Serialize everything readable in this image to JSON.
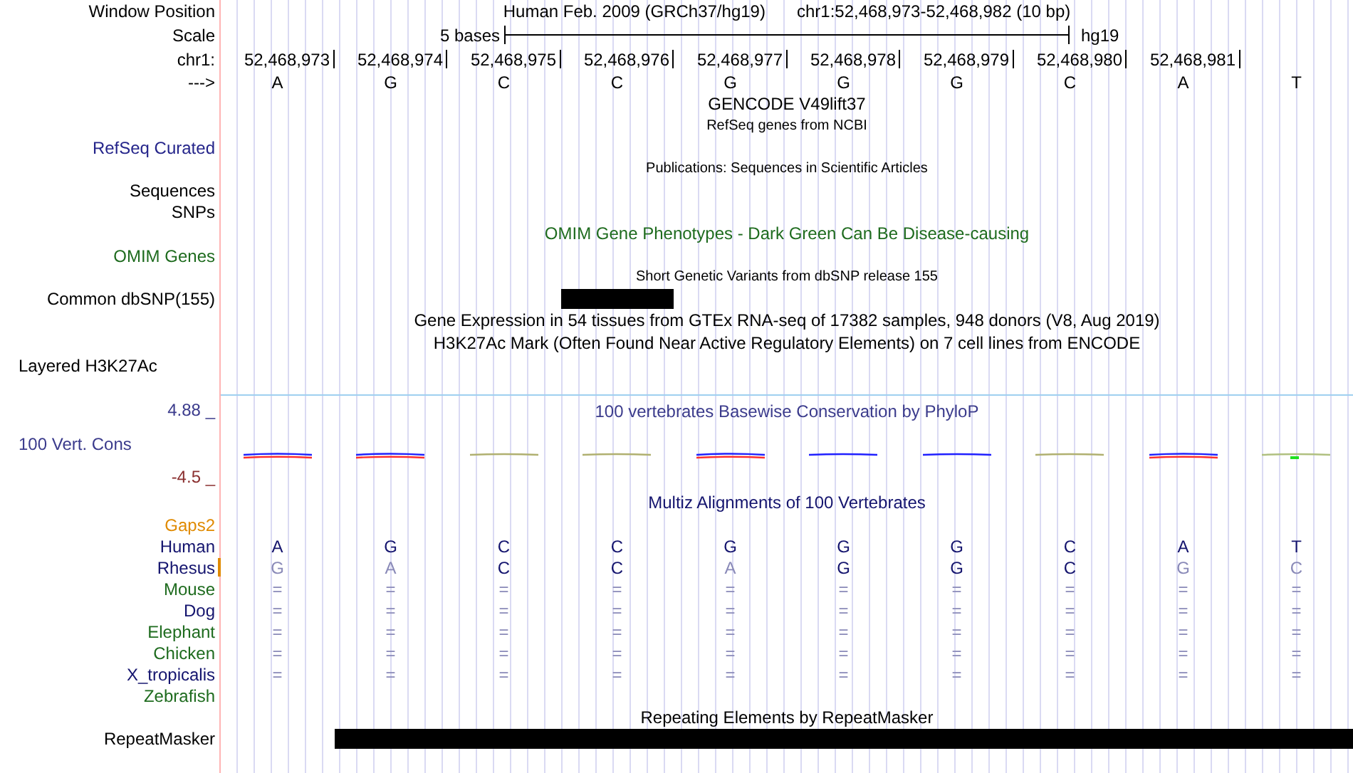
{
  "header": {
    "label": "Window Position",
    "assembly": "Human Feb. 2009 (GRCh37/hg19)",
    "position": "chr1:52,468,973-52,468,982 (10 bp)"
  },
  "scale": {
    "label": "Scale",
    "bar_label": "5 bases",
    "assembly": "hg19"
  },
  "ruler": {
    "label": "chr1:",
    "positions": [
      "52,468,973",
      "52,468,974",
      "52,468,975",
      "52,468,976",
      "52,468,977",
      "52,468,978",
      "52,468,979",
      "52,468,980",
      "52,468,981"
    ]
  },
  "sequence": {
    "label": "--->",
    "bases": [
      "A",
      "G",
      "C",
      "C",
      "G",
      "G",
      "G",
      "C",
      "A",
      "T"
    ]
  },
  "tracks": [
    {
      "kind": "title",
      "text": "GENCODE V49lift37",
      "color": "#000000"
    },
    {
      "kind": "subtitle",
      "text": "RefSeq genes from NCBI",
      "color": "#000000"
    },
    {
      "kind": "label",
      "text": "RefSeq Curated",
      "color": "#24248a"
    },
    {
      "kind": "subtitle",
      "text": "Publications: Sequences in Scientific Articles",
      "color": "#000000"
    },
    {
      "kind": "label",
      "text": "Sequences",
      "color": "#000000"
    },
    {
      "kind": "label",
      "text": "SNPs",
      "color": "#000000"
    },
    {
      "kind": "title",
      "text": "OMIM Gene Phenotypes - Dark Green Can Be Disease-causing",
      "color": "#1e6b1e"
    },
    {
      "kind": "label",
      "text": "OMIM Genes",
      "color": "#1e6b1e"
    },
    {
      "kind": "subtitle",
      "text": "Short Genetic Variants from dbSNP release 155",
      "color": "#000000"
    },
    {
      "kind": "feature",
      "text": "Common dbSNP(155)",
      "color": "#000000",
      "covered": [
        false,
        false,
        false,
        true,
        false,
        false,
        false,
        false,
        false,
        false
      ]
    },
    {
      "kind": "title",
      "text": "Gene Expression in 54 tissues from GTEx RNA-seq of 17382 samples, 948 donors (V8, Aug 2019)",
      "color": "#000000"
    },
    {
      "kind": "title",
      "text": "H3K27Ac Mark (Often Found Near Active Regulatory Elements) on 7 cell lines from ENCODE",
      "color": "#000000"
    },
    {
      "kind": "side_label",
      "text": "Layered H3K27Ac",
      "color": "#000000"
    }
  ],
  "conservation": {
    "title": "100 vertebrates Basewise Conservation by PhyloP",
    "label": "100 Vert. Cons",
    "max": "4.88 _",
    "min": "-4.5 _",
    "marks": [
      {
        "kind": "mixed"
      },
      {
        "kind": "mixed"
      },
      {
        "kind": "faint"
      },
      {
        "kind": "faint"
      },
      {
        "kind": "mixed"
      },
      {
        "kind": "blue"
      },
      {
        "kind": "blue"
      },
      {
        "kind": "faint"
      },
      {
        "kind": "mixed"
      },
      {
        "kind": "green"
      }
    ]
  },
  "multiz": {
    "title": "Multiz Alignments of 100 Vertebrates",
    "gaps_label": "Gaps2",
    "species": [
      {
        "name": "Human",
        "color": "#14146e",
        "insertion": false,
        "bases": [
          {
            "base": "A",
            "match": true
          },
          {
            "base": "G",
            "match": true
          },
          {
            "base": "C",
            "match": true
          },
          {
            "base": "C",
            "match": true
          },
          {
            "base": "G",
            "match": true
          },
          {
            "base": "G",
            "match": true
          },
          {
            "base": "G",
            "match": true
          },
          {
            "base": "C",
            "match": true
          },
          {
            "base": "A",
            "match": true
          },
          {
            "base": "T",
            "match": true
          }
        ]
      },
      {
        "name": "Rhesus",
        "color": "#14146e",
        "insertion": true,
        "bases": [
          {
            "base": "G",
            "match": false
          },
          {
            "base": "A",
            "match": false
          },
          {
            "base": "C",
            "match": true
          },
          {
            "base": "C",
            "match": true
          },
          {
            "base": "A",
            "match": false
          },
          {
            "base": "G",
            "match": true
          },
          {
            "base": "G",
            "match": true
          },
          {
            "base": "C",
            "match": true
          },
          {
            "base": "G",
            "match": false
          },
          {
            "base": "C",
            "match": false
          }
        ]
      },
      {
        "name": "Mouse",
        "color": "#1e6b1e",
        "insertion": false,
        "bases": [
          {
            "base": "=",
            "match": false
          },
          {
            "base": "=",
            "match": false
          },
          {
            "base": "=",
            "match": false
          },
          {
            "base": "=",
            "match": false
          },
          {
            "base": "=",
            "match": false
          },
          {
            "base": "=",
            "match": false
          },
          {
            "base": "=",
            "match": false
          },
          {
            "base": "=",
            "match": false
          },
          {
            "base": "=",
            "match": false
          },
          {
            "base": "=",
            "match": false
          }
        ]
      },
      {
        "name": "Dog",
        "color": "#14146e",
        "insertion": false,
        "bases": [
          {
            "base": "=",
            "match": false
          },
          {
            "base": "=",
            "match": false
          },
          {
            "base": "=",
            "match": false
          },
          {
            "base": "=",
            "match": false
          },
          {
            "base": "=",
            "match": false
          },
          {
            "base": "=",
            "match": false
          },
          {
            "base": "=",
            "match": false
          },
          {
            "base": "=",
            "match": false
          },
          {
            "base": "=",
            "match": false
          },
          {
            "base": "=",
            "match": false
          }
        ]
      },
      {
        "name": "Elephant",
        "color": "#1e6b1e",
        "insertion": false,
        "bases": [
          {
            "base": "=",
            "match": false
          },
          {
            "base": "=",
            "match": false
          },
          {
            "base": "=",
            "match": false
          },
          {
            "base": "=",
            "match": false
          },
          {
            "base": "=",
            "match": false
          },
          {
            "base": "=",
            "match": false
          },
          {
            "base": "=",
            "match": false
          },
          {
            "base": "=",
            "match": false
          },
          {
            "base": "=",
            "match": false
          },
          {
            "base": "=",
            "match": false
          }
        ]
      },
      {
        "name": "Chicken",
        "color": "#1e6b1e",
        "insertion": false,
        "bases": [
          {
            "base": "=",
            "match": false
          },
          {
            "base": "=",
            "match": false
          },
          {
            "base": "=",
            "match": false
          },
          {
            "base": "=",
            "match": false
          },
          {
            "base": "=",
            "match": false
          },
          {
            "base": "=",
            "match": false
          },
          {
            "base": "=",
            "match": false
          },
          {
            "base": "=",
            "match": false
          },
          {
            "base": "=",
            "match": false
          },
          {
            "base": "=",
            "match": false
          }
        ]
      },
      {
        "name": "X_tropicalis",
        "color": "#14146e",
        "insertion": false,
        "bases": [
          {
            "base": "=",
            "match": false
          },
          {
            "base": "=",
            "match": false
          },
          {
            "base": "=",
            "match": false
          },
          {
            "base": "=",
            "match": false
          },
          {
            "base": "=",
            "match": false
          },
          {
            "base": "=",
            "match": false
          },
          {
            "base": "=",
            "match": false
          },
          {
            "base": "=",
            "match": false
          },
          {
            "base": "=",
            "match": false
          },
          {
            "base": "=",
            "match": false
          }
        ]
      },
      {
        "name": "Zebrafish",
        "color": "#1e6b1e",
        "insertion": false
      }
    ]
  },
  "repeats": {
    "title": "Repeating Elements by RepeatMasker",
    "label": "RepeatMasker",
    "covered": [
      false,
      true,
      true,
      true,
      true,
      true,
      true,
      true,
      true,
      true
    ]
  }
}
